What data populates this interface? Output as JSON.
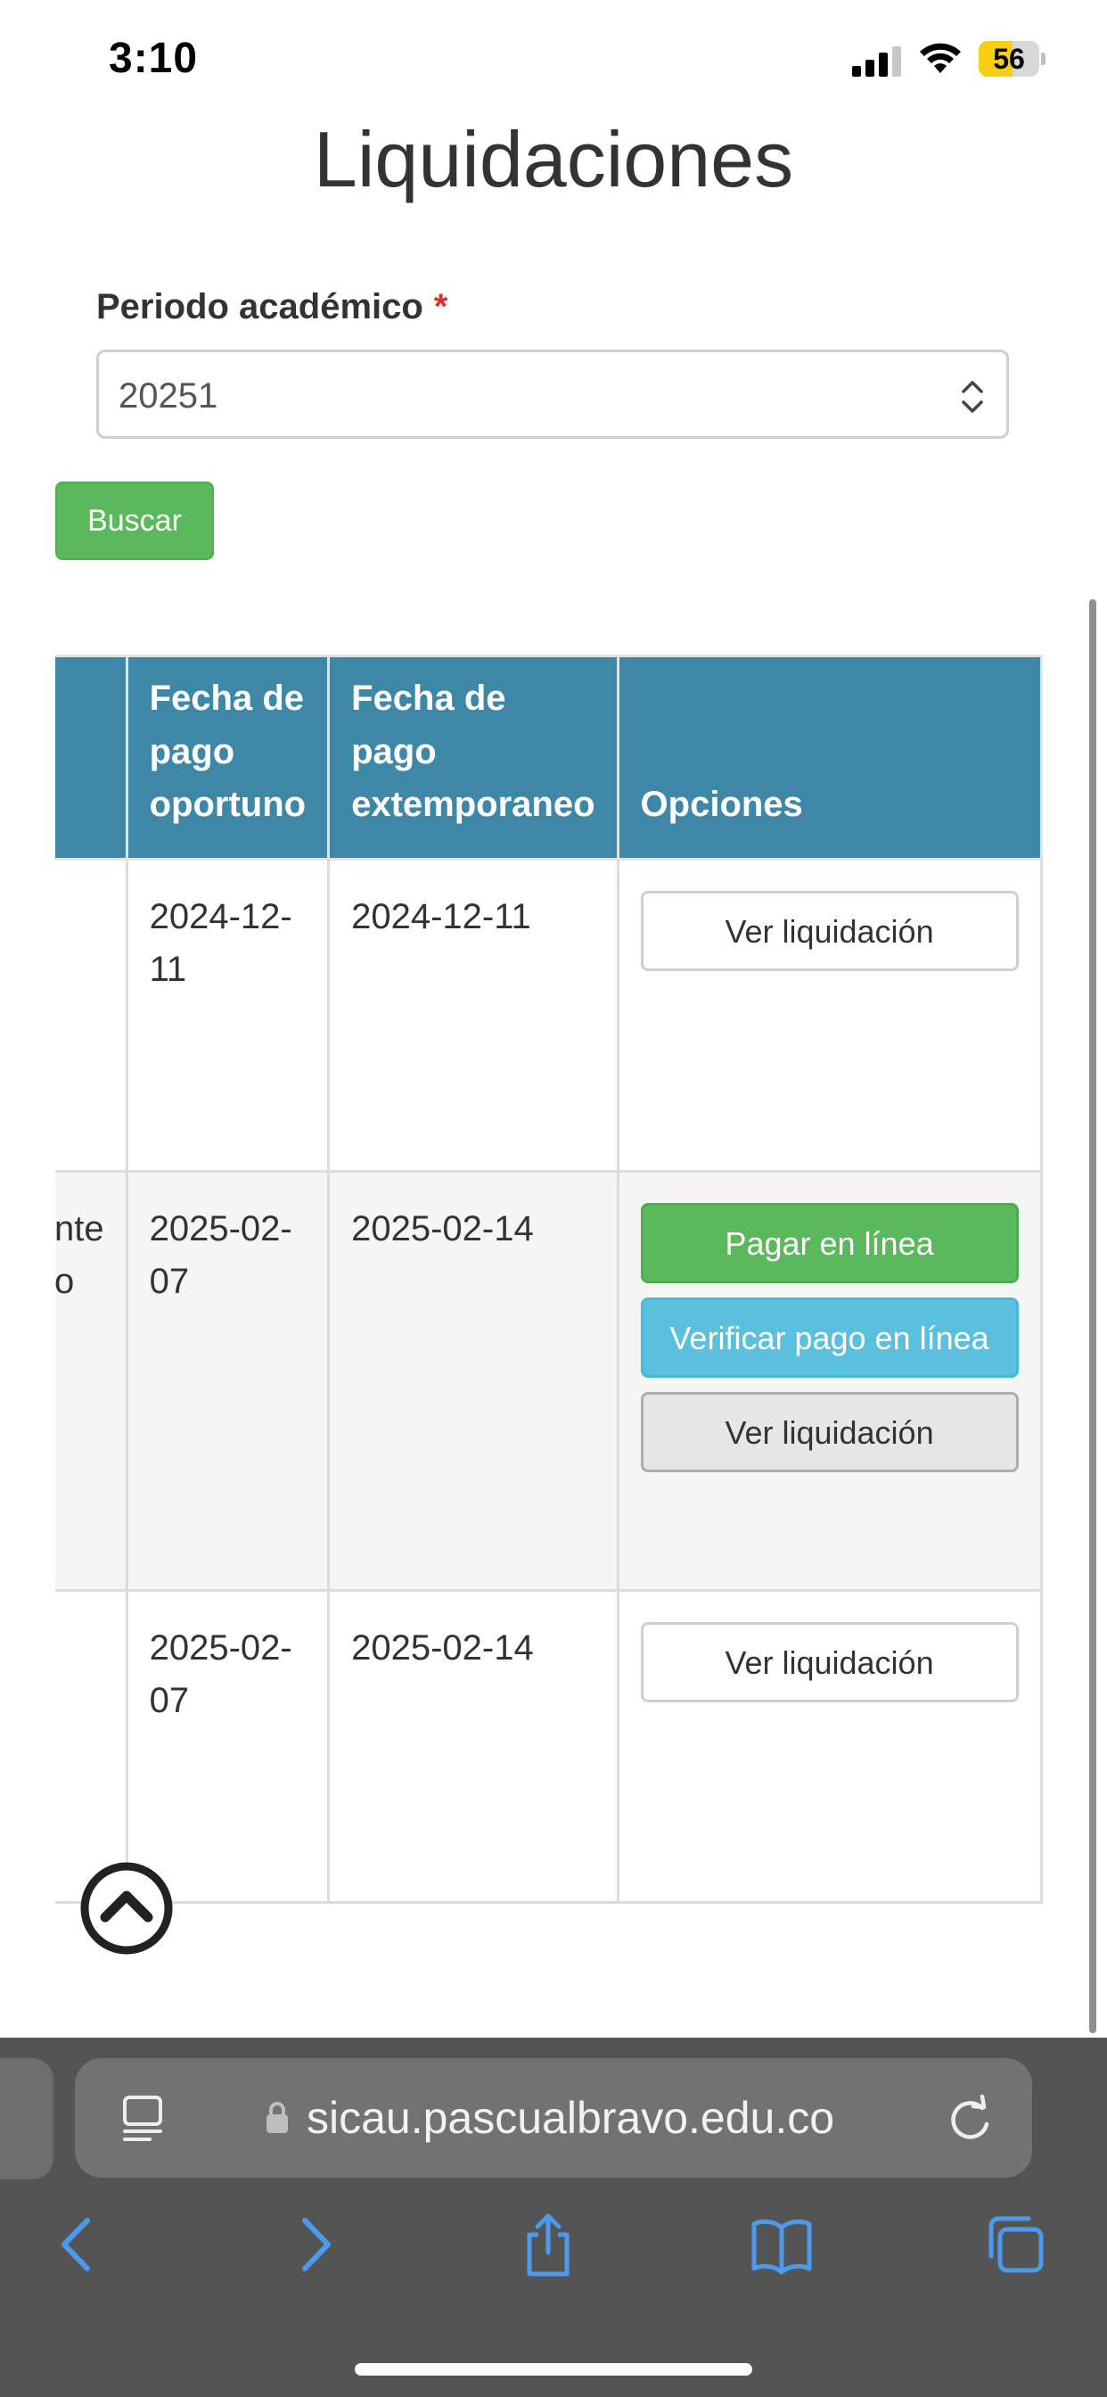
{
  "status_bar": {
    "time": "3:10",
    "battery_level": "56",
    "battery_color": "#f6cf12"
  },
  "page": {
    "title": "Liquidaciones",
    "field_label": "Periodo académico",
    "required_mark": "*",
    "period_value": "20251",
    "search_button": "Buscar"
  },
  "table": {
    "headers": [
      "Fecha de pago oportuno",
      "Fecha de pago extemporaneo",
      "Opciones"
    ],
    "rows": [
      {
        "clipped_text": "",
        "fecha_oportuno": "2024-12-11",
        "fecha_extemporaneo": "2024-12-11",
        "actions": {
          "ver": "Ver liquidación"
        }
      },
      {
        "clipped_text": "nte o",
        "fecha_oportuno": "2025-02-07",
        "fecha_extemporaneo": "2025-02-14",
        "actions": {
          "pagar": "Pagar en línea",
          "verificar": "Verificar pago en línea",
          "ver": "Ver liquidación"
        }
      },
      {
        "clipped_text": "",
        "fecha_oportuno": "2025-02-07",
        "fecha_extemporaneo": "2025-02-14",
        "actions": {
          "ver": "Ver liquidación"
        }
      }
    ]
  },
  "browser": {
    "url": "sicau.pascualbravo.edu.co",
    "icons": [
      "reader-icon",
      "lock-icon",
      "reload-icon",
      "back-icon",
      "forward-icon",
      "share-icon",
      "bookmarks-icon",
      "tabs-icon"
    ]
  },
  "colors": {
    "header_bg": "#3f87a6",
    "success": "#5cb85c",
    "info": "#5bc0de",
    "required": "#d9302f"
  }
}
